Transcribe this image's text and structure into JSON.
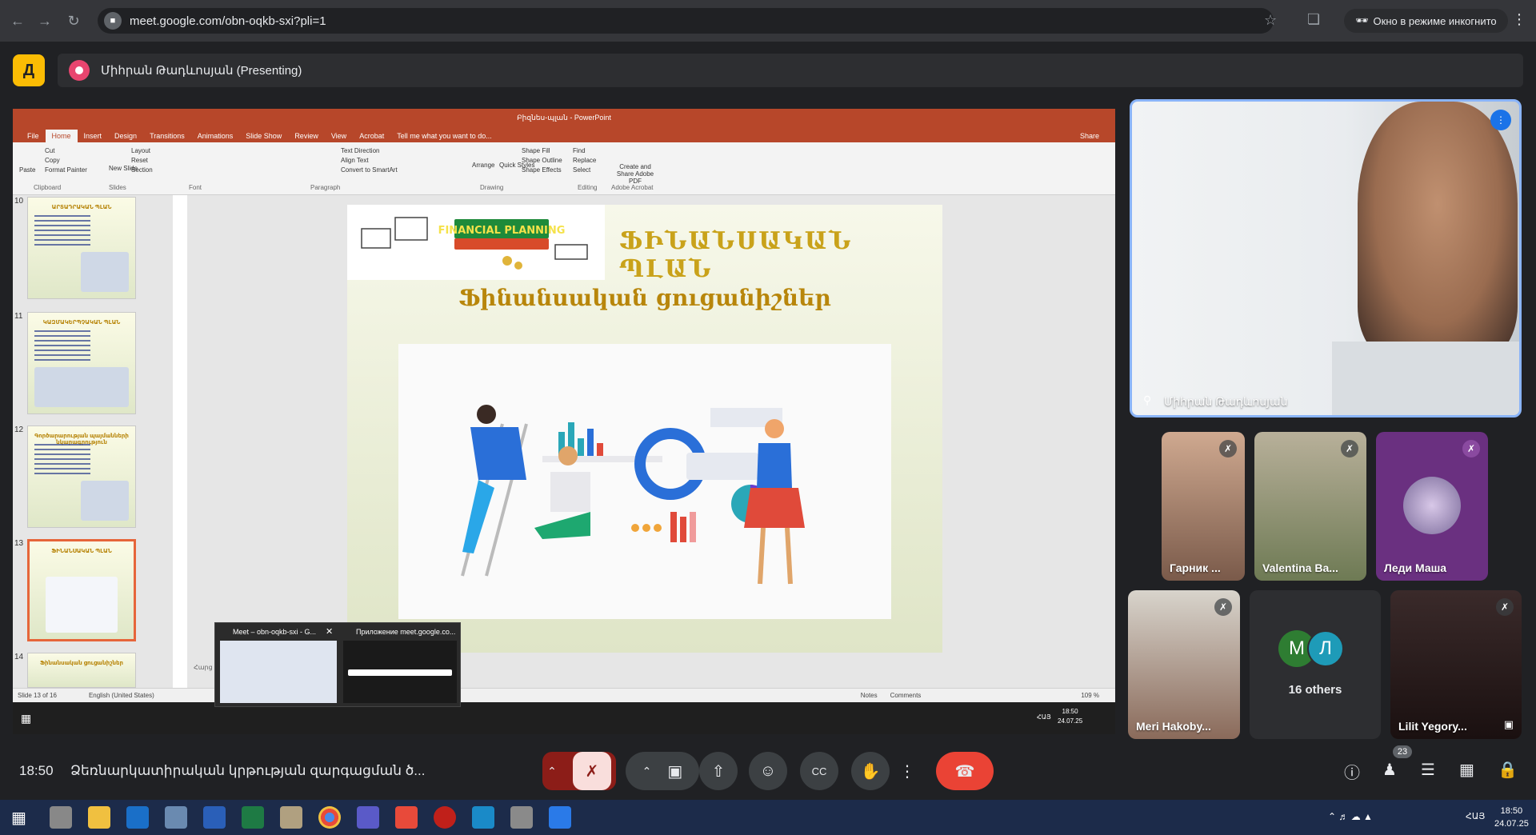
{
  "browser": {
    "url": "meet.google.com/obn-oqkb-sxi?pli=1",
    "incognito_label": "Окно в режиме инкогнито"
  },
  "meet": {
    "presenting_label": "Միհրան Թադևոսյան (Presenting)",
    "clock": "18:50",
    "meeting_title": "Ձեռնարկատիրական կրթության զարգացման ծ...",
    "people_count": "23"
  },
  "powerpoint": {
    "title": "Բիզնես-պլան - PowerPoint",
    "tabs": [
      "File",
      "Home",
      "Insert",
      "Design",
      "Transitions",
      "Animations",
      "Slide Show",
      "Review",
      "View",
      "Acrobat",
      "Tell me what you want to do...",
      "Share"
    ],
    "ribbon_groups": [
      "Clipboard",
      "Slides",
      "Font",
      "Paragraph",
      "Drawing",
      "Editing",
      "Adobe Acrobat"
    ],
    "ribbon_items": {
      "paste": "Paste",
      "cut": "Cut",
      "copy": "Copy",
      "format_painter": "Format Painter",
      "new_slide": "New Slide",
      "layout": "Layout",
      "reset": "Reset",
      "section": "Section",
      "text_direction": "Text Direction",
      "align_text": "Align Text",
      "convert_smartart": "Convert to SmartArt",
      "arrange": "Arrange",
      "quick_styles": "Quick Styles",
      "shape_fill": "Shape Fill",
      "shape_outline": "Shape Outline",
      "shape_effects": "Shape Effects",
      "find": "Find",
      "replace": "Replace",
      "select": "Select",
      "create_share_pdf": "Create and Share Adobe PDF"
    },
    "thumbnails": [
      {
        "num": "10",
        "title": "ԱՐՏԱԴՐԱԿԱՆ ՊԼԱՆ"
      },
      {
        "num": "11",
        "title": "ԿԱԶՄԱԿԵՐՊՉԱԿԱՆ ՊԼԱՆ"
      },
      {
        "num": "12",
        "title": "Գործարարության պայմանների նկարագրություն"
      },
      {
        "num": "13",
        "title": "ՖԻՆԱՆՍԱԿԱՆ ՊԼԱՆ"
      },
      {
        "num": "14",
        "title": "Ֆինանսական ցուցանիշներ"
      }
    ],
    "slide": {
      "title": "ՖԻՆԱՆՍԱԿԱՆ ՊԼԱՆ",
      "subtitle": "Ֆինանսական ցուցանիշներ",
      "header_text": "FINANCIAL PLANNING"
    },
    "notes_placeholder": "Հարց",
    "status": {
      "slide_info": "Slide 13 of 16",
      "language": "English (United States)",
      "notes": "Notes",
      "comments": "Comments",
      "zoom": "109 %"
    }
  },
  "inner_taskbar": {
    "time": "18:50",
    "date": "24.07.25",
    "lang": "ՀԱՅ"
  },
  "tab_preview": {
    "tab1": "Meet – obn-oqkb-sxi - G...",
    "tab2": "Приложение meet.google.co..."
  },
  "participants": {
    "presenter": "Միհրան Թադևոսյան",
    "tiles": [
      {
        "name": "Гарник ..."
      },
      {
        "name": "Valentina Ba..."
      },
      {
        "name": "Леди Маша"
      },
      {
        "name": "Meri Hakoby..."
      },
      {
        "name": "16 others"
      },
      {
        "name": "Lilit Yegory..."
      }
    ],
    "others_initials": [
      "М",
      "Л"
    ]
  },
  "taskbar": {
    "time": "18:50",
    "date": "24.07.25",
    "lang": "ՀԱՅ"
  },
  "colors": {
    "ppt_accent": "#b7472a",
    "meet_hangup": "#ea4335",
    "active_speaker": "#8ab4f8",
    "slide_title": "#c9a21a"
  }
}
